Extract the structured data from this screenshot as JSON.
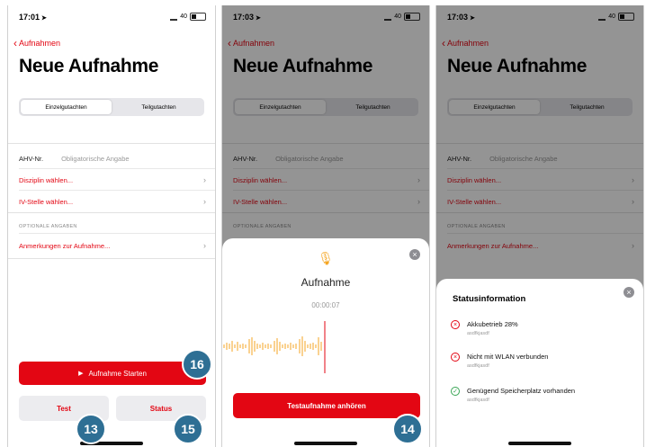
{
  "status_bar": {
    "time": "17:01",
    "time_2": "17:03",
    "time_3": "17:03",
    "battery": "40"
  },
  "nav": {
    "back_label": "Aufnahmen"
  },
  "page": {
    "title": "Neue Aufnahme"
  },
  "segment": {
    "option_1": "Einzelgutachten",
    "option_2": "Teilgutachten"
  },
  "form": {
    "ahv_label": "AHV-Nr.",
    "ahv_placeholder": "Obligatorische Angabe",
    "disziplin": "Disziplin wählen...",
    "iv_stelle": "IV-Stelle wählen...",
    "optional_header": "OPTIONALE ANGABEN",
    "anmerkungen": "Anmerkungen zur Aufnahme..."
  },
  "buttons": {
    "start": "Aufnahme Starten",
    "test": "Test",
    "status": "Status"
  },
  "badges": {
    "b16": "16",
    "b13": "13",
    "b15": "15",
    "b14": "14"
  },
  "recording_sheet": {
    "title": "Aufnahme",
    "timer": "00:00:07",
    "listen_button": "Testaufnahme anhören",
    "icon": "microphone-icon"
  },
  "status_sheet": {
    "title": "Statusinformation",
    "items": [
      {
        "state": "error",
        "text": "Akkubetrieb 28%",
        "sub": "asdfkjasdf"
      },
      {
        "state": "error",
        "text": "Nicht mit WLAN verbunden",
        "sub": "asdfkjasdf"
      },
      {
        "state": "ok",
        "text": "Genügend Speicherplatz vorhanden",
        "sub": "asdfkjasdf"
      }
    ]
  },
  "colors": {
    "accent": "#e30613",
    "badge": "#2e6f94",
    "ok": "#3aa655",
    "mic": "#f5a623"
  }
}
